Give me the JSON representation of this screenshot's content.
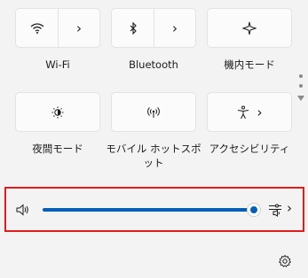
{
  "tiles": [
    {
      "label": "Wi-Fi",
      "icon": "wifi-icon",
      "chevron": "›"
    },
    {
      "label": "Bluetooth",
      "icon": "bluetooth-icon",
      "chevron": "›"
    },
    {
      "label": "機内モード",
      "icon": "airplane-icon"
    },
    {
      "label": "夜間モード",
      "icon": "night-light-icon"
    },
    {
      "label": "モバイル ホットスポット",
      "icon": "hotspot-icon"
    },
    {
      "label": "アクセシビリティ",
      "icon": "accessibility-icon",
      "chevron": "›"
    }
  ],
  "volume": {
    "level": 1.0,
    "icon": "speaker-icon",
    "output_icon": "audio-output-icon",
    "chevron": "›"
  },
  "footer": {
    "settings_icon": "gear-icon"
  },
  "colors": {
    "accent": "#005fb8",
    "highlight": "#e21b1b"
  }
}
